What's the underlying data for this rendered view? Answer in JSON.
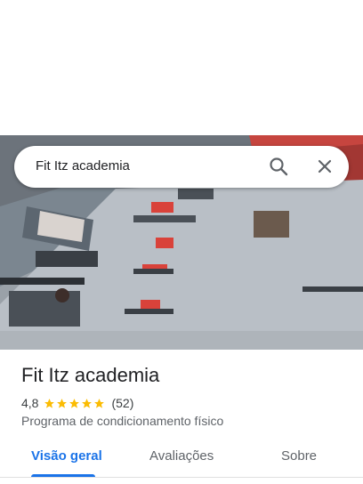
{
  "search": {
    "query": "Fit Itz academia"
  },
  "place": {
    "title": "Fit Itz academia",
    "rating": "4,8",
    "stars": 5,
    "reviews_count": "(52)",
    "category": "Programa de condicionamento físico"
  },
  "tabs": [
    {
      "label": "Visão geral",
      "active": true
    },
    {
      "label": "Avaliações",
      "active": false
    },
    {
      "label": "Sobre",
      "active": false
    }
  ],
  "colors": {
    "accent": "#1a73e8",
    "star": "#fbbc04",
    "text": "#202124",
    "muted": "#5f6368"
  },
  "icons": {
    "search": "search-icon",
    "close": "close-icon",
    "star": "star-icon"
  }
}
